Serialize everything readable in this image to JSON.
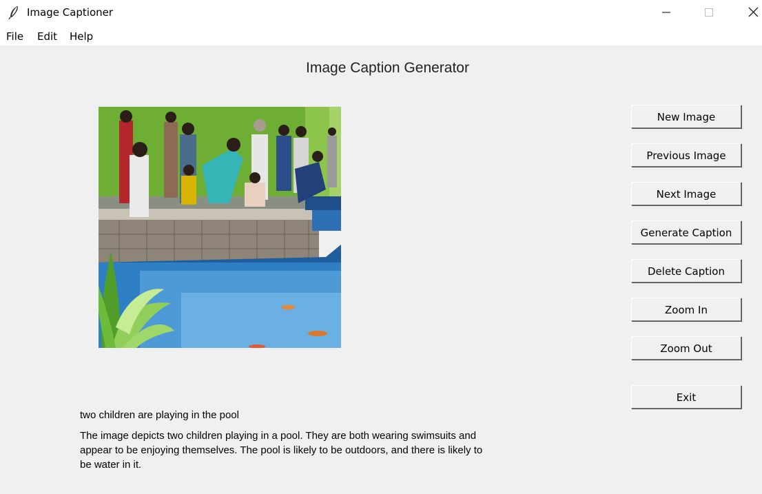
{
  "window": {
    "title": "Image Captioner",
    "app_icon": "feather-icon",
    "controls": [
      "minimize-icon",
      "maximize-icon",
      "close-icon"
    ]
  },
  "menu": {
    "items": [
      "File",
      "Edit",
      "Help"
    ]
  },
  "main": {
    "heading": "Image Caption Generator",
    "image": "photo of people watching fish in an indoor pool"
  },
  "buttons": [
    "New Image",
    "Previous Image",
    "Next Image",
    "Generate Caption",
    "Delete Caption",
    "Zoom In",
    "Zoom Out",
    "Exit"
  ],
  "captions": {
    "short": "two children are playing in the pool",
    "long": "The image depicts two children playing in a pool. They are both wearing swimsuits and appear to be enjoying themselves. The pool is likely to be outdoors, and there is likely to be water in it."
  }
}
